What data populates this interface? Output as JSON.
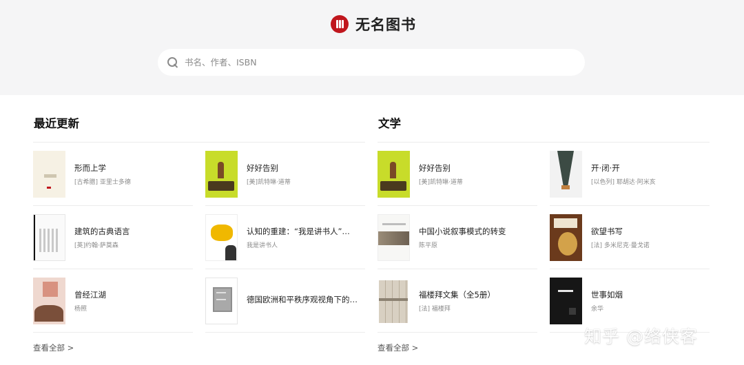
{
  "brand": {
    "name": "无名图书",
    "accent": "#c0161d"
  },
  "search": {
    "placeholder": "书名、作者、ISBN",
    "value": "",
    "icon": "search-icon"
  },
  "sections": [
    {
      "title": "最近更新",
      "view_all": "查看全部 >",
      "books": [
        {
          "title": "形而上学",
          "author": "[古希腊] 亚里士多德"
        },
        {
          "title": "好好告别",
          "author": "[美]凯特琳·道蒂"
        },
        {
          "title": "建筑的古典语言",
          "author": "[英]约翰·萨莫森"
        },
        {
          "title": "认知的重建：“我是讲书人”…",
          "author": "我是讲书人"
        },
        {
          "title": "曾经江湖",
          "author": "杨照"
        },
        {
          "title": "德国欧洲和平秩序观视角下的…",
          "author": ""
        }
      ]
    },
    {
      "title": "文学",
      "view_all": "查看全部 >",
      "books": [
        {
          "title": "好好告别",
          "author": "[美]凯特琳·道蒂"
        },
        {
          "title": "开·闭·开",
          "author": "[以色列] 耶胡达·阿米亥"
        },
        {
          "title": "中国小说叙事模式的转变",
          "author": "陈平原"
        },
        {
          "title": "欲望书写",
          "author": "[法] 多米尼克·曼戈诺"
        },
        {
          "title": "福楼拜文集（全5册）",
          "author": "[法] 福楼拜"
        },
        {
          "title": "世事如烟",
          "author": "余华"
        }
      ]
    }
  ],
  "watermark": "知乎 @络侠客"
}
